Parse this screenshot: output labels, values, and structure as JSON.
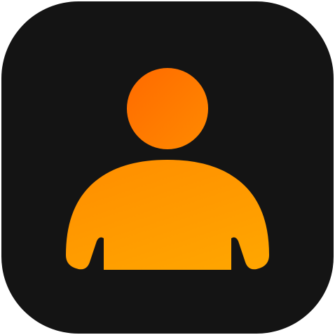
{
  "icon": {
    "name": "user-profile-icon",
    "background_color": "#141414",
    "figure_gradient_start": "#ff6a00",
    "figure_gradient_end": "#ffa500"
  }
}
